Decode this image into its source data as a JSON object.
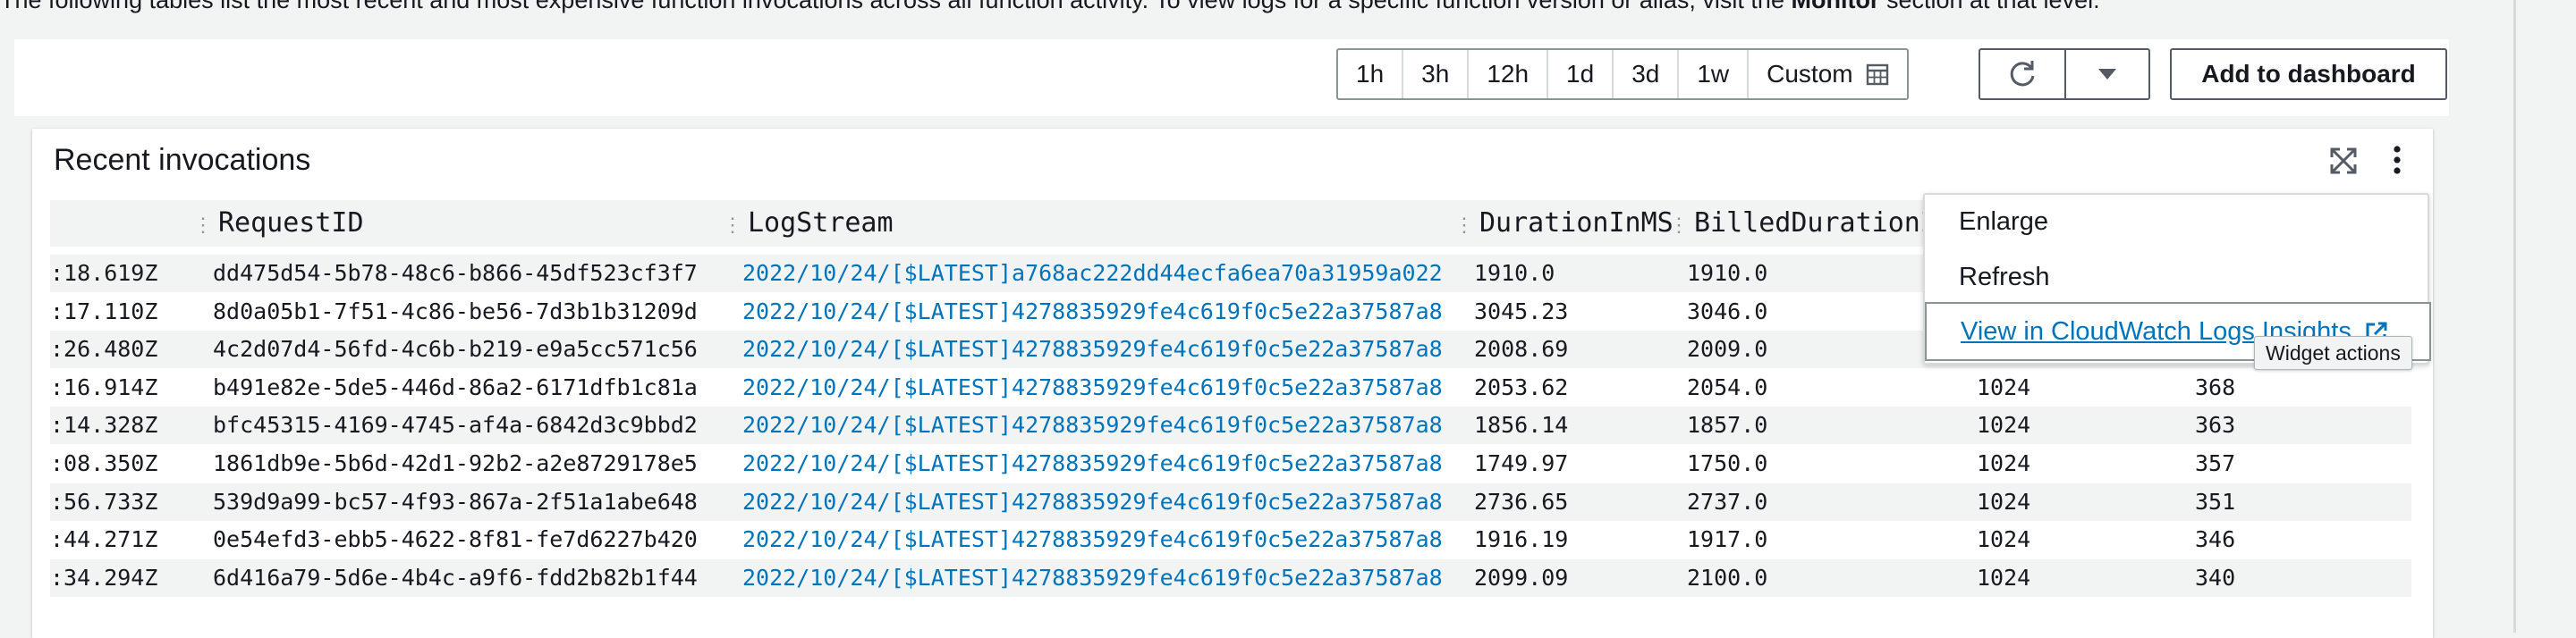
{
  "intro": {
    "text_before": "The following tables list the most recent and most expensive function invocations across all function activity. To view logs for a specific function version or alias, visit the ",
    "bold": "Monitor",
    "text_after": " section at that level."
  },
  "toolbar": {
    "ranges": [
      "1h",
      "3h",
      "12h",
      "1d",
      "3d",
      "1w"
    ],
    "custom_label": "Custom",
    "add_label": "Add to dashboard"
  },
  "widget": {
    "title": "Recent invocations",
    "columns": {
      "request_id": "RequestID",
      "log_stream": "LogStream",
      "duration": "DurationInMS",
      "billed": "BilledDurationIn…"
    },
    "rows": [
      {
        "ts": ":18.619Z",
        "req": "dd475d54-5b78-48c6-b866-45df523cf3f7",
        "log": "2022/10/24/[$LATEST]a768ac222dd44ecfa6ea70a31959a022",
        "dur": "1910.0",
        "billed": "1910.0",
        "mem": "",
        "used": ""
      },
      {
        "ts": ":17.110Z",
        "req": "8d0a05b1-7f51-4c86-be56-7d3b1b31209d",
        "log": "2022/10/24/[$LATEST]4278835929fe4c619f0c5e22a37587a8",
        "dur": "3045.23",
        "billed": "3046.0",
        "mem": "",
        "used": ""
      },
      {
        "ts": ":26.480Z",
        "req": "4c2d07d4-56fd-4c6b-b219-e9a5cc571c56",
        "log": "2022/10/24/[$LATEST]4278835929fe4c619f0c5e22a37587a8",
        "dur": "2008.69",
        "billed": "2009.0",
        "mem": "",
        "used": ""
      },
      {
        "ts": ":16.914Z",
        "req": "b491e82e-5de5-446d-86a2-6171dfb1c81a",
        "log": "2022/10/24/[$LATEST]4278835929fe4c619f0c5e22a37587a8",
        "dur": "2053.62",
        "billed": "2054.0",
        "mem": "1024",
        "used": "368"
      },
      {
        "ts": ":14.328Z",
        "req": "bfc45315-4169-4745-af4a-6842d3c9bbd2",
        "log": "2022/10/24/[$LATEST]4278835929fe4c619f0c5e22a37587a8",
        "dur": "1856.14",
        "billed": "1857.0",
        "mem": "1024",
        "used": "363"
      },
      {
        "ts": ":08.350Z",
        "req": "1861db9e-5b6d-42d1-92b2-a2e8729178e5",
        "log": "2022/10/24/[$LATEST]4278835929fe4c619f0c5e22a37587a8",
        "dur": "1749.97",
        "billed": "1750.0",
        "mem": "1024",
        "used": "357"
      },
      {
        "ts": ":56.733Z",
        "req": "539d9a99-bc57-4f93-867a-2f51a1abe648",
        "log": "2022/10/24/[$LATEST]4278835929fe4c619f0c5e22a37587a8",
        "dur": "2736.65",
        "billed": "2737.0",
        "mem": "1024",
        "used": "351"
      },
      {
        "ts": ":44.271Z",
        "req": "0e54efd3-ebb5-4622-8f81-fe7d6227b420",
        "log": "2022/10/24/[$LATEST]4278835929fe4c619f0c5e22a37587a8",
        "dur": "1916.19",
        "billed": "1917.0",
        "mem": "1024",
        "used": "346"
      },
      {
        "ts": ":34.294Z",
        "req": "6d416a79-5d6e-4b4c-a9f6-fdd2b82b1f44",
        "log": "2022/10/24/[$LATEST]4278835929fe4c619f0c5e22a37587a8",
        "dur": "2099.09",
        "billed": "2100.0",
        "mem": "1024",
        "used": "340"
      }
    ]
  },
  "menu": {
    "enlarge": "Enlarge",
    "refresh": "Refresh",
    "insights": "View in CloudWatch Logs Insights"
  },
  "tooltip": "Widget actions",
  "colors": {
    "link": "#0073bb",
    "row_stripe": "#f2f3f3",
    "border": "#879596"
  },
  "icons": {
    "calendar": "calendar-icon",
    "refresh": "refresh-icon",
    "caret": "caret-down-icon",
    "expand": "expand-icon",
    "kebab": "more-vertical-icon",
    "external": "external-link-icon"
  }
}
